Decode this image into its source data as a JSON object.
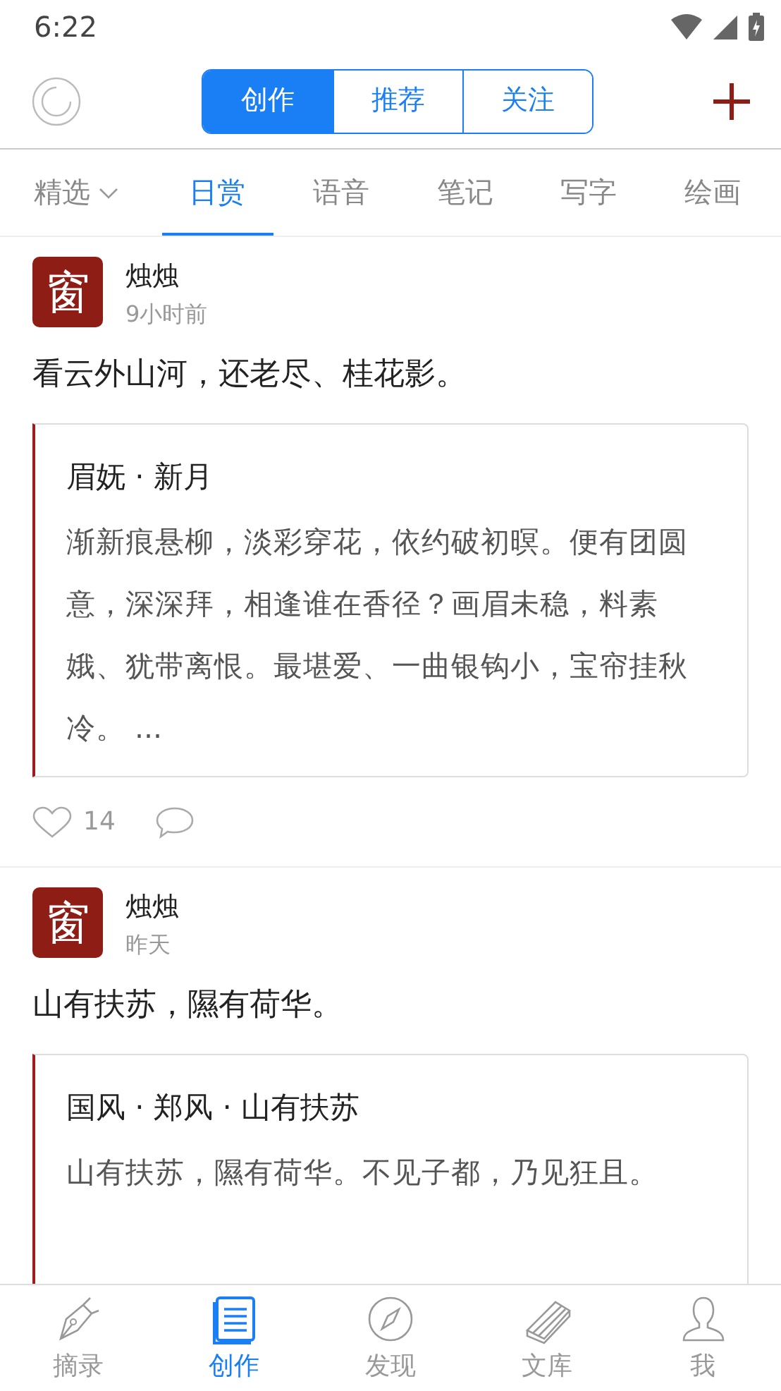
{
  "status_bar": {
    "time": "6:22"
  },
  "header": {
    "segments": [
      {
        "label": "创作",
        "selected": true
      },
      {
        "label": "推荐",
        "selected": false
      },
      {
        "label": "关注",
        "selected": false
      }
    ]
  },
  "categories": [
    {
      "label": "精选",
      "dropdown": true,
      "selected": false
    },
    {
      "label": "日赏",
      "dropdown": false,
      "selected": true
    },
    {
      "label": "语音",
      "dropdown": false,
      "selected": false
    },
    {
      "label": "笔记",
      "dropdown": false,
      "selected": false
    },
    {
      "label": "写字",
      "dropdown": false,
      "selected": false
    },
    {
      "label": "绘画",
      "dropdown": false,
      "selected": false
    }
  ],
  "posts": [
    {
      "avatar_glyph": "窗",
      "author": "烛烛",
      "time": "9小时前",
      "text": "看云外山河，还老尽、桂花影。",
      "quote": {
        "title": "眉妩 · 新月",
        "body": "渐新痕悬柳，淡彩穿花，依约破初暝。便有团圆意，深深拜，相逢谁在香径？画眉未稳，料素娥、犹带离恨。最堪爱、一曲银钩小，宝帘挂秋冷。 ..."
      },
      "likes": "14"
    },
    {
      "avatar_glyph": "窗",
      "author": "烛烛",
      "time": "昨天",
      "text": "山有扶苏，隰有荷华。",
      "quote": {
        "title": "国风 · 郑风 · 山有扶苏",
        "body": "山有扶苏，隰有荷华。不见子都，乃见狂且。"
      }
    }
  ],
  "bottom_nav": [
    {
      "label": "摘录",
      "selected": false
    },
    {
      "label": "创作",
      "selected": true
    },
    {
      "label": "发现",
      "selected": false
    },
    {
      "label": "文库",
      "selected": false
    },
    {
      "label": "我",
      "selected": false
    }
  ]
}
